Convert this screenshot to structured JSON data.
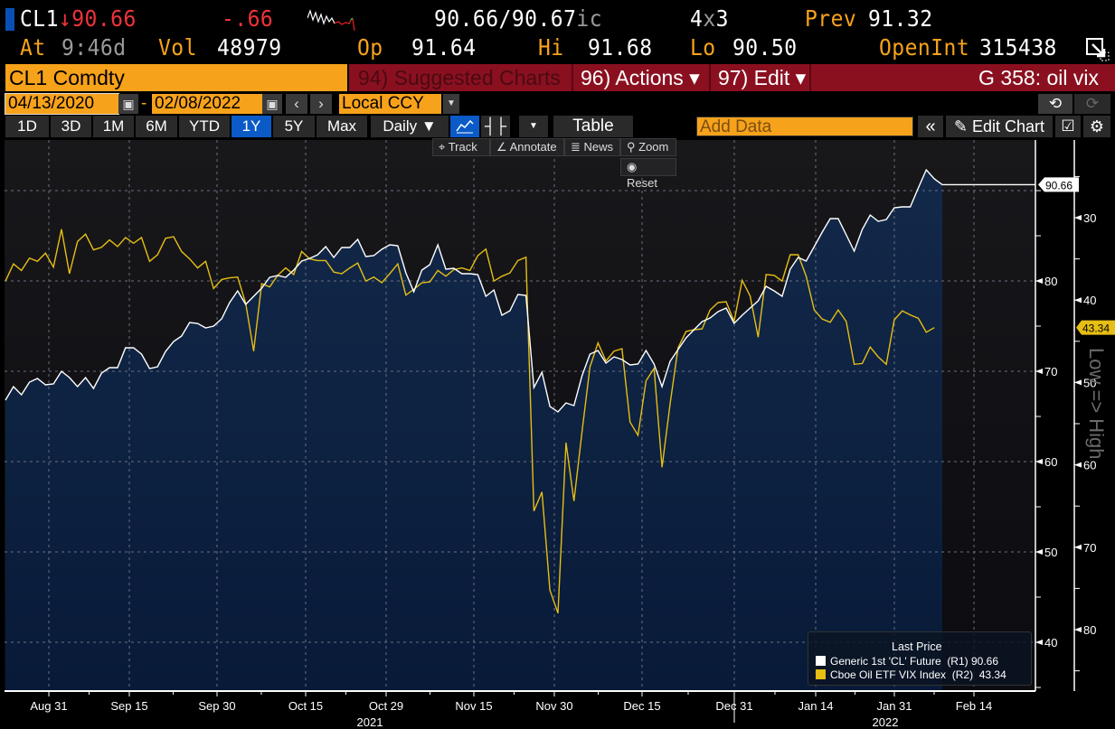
{
  "header": {
    "ticker": "CL1",
    "arrow": "↓",
    "last": "90.66",
    "change": "-.66",
    "bid_ask": "90.66",
    "ask": "/90.67",
    "ask_suffix": "ic",
    "size_a": "4",
    "size_x": "x",
    "size_b": "3",
    "prev_label": "Prev",
    "prev": "91.32",
    "at_label": "At",
    "time": "9:46d",
    "vol_label": "Vol",
    "vol": "48979",
    "op_label": "Op",
    "op": "91.64",
    "hi_label": "Hi",
    "hi": "91.68",
    "lo_label": "Lo",
    "lo": "90.50",
    "oi_label": "OpenInt",
    "oi": "315438"
  },
  "command": {
    "security": "CL1 Comdty",
    "suggested": "94) Suggested Charts",
    "actions": "96) Actions ▾",
    "edit": "97) Edit ▾",
    "title": "G 358: oil vix"
  },
  "range": {
    "start": "04/13/2020",
    "sep": "-",
    "end": "02/08/2022",
    "currency": "Local CCY"
  },
  "toolbar": {
    "periods": [
      "1D",
      "3D",
      "1M",
      "6M",
      "YTD",
      "1Y",
      "5Y",
      "Max"
    ],
    "selected_period": "1Y",
    "frequency": "Daily ▼",
    "table": "Table",
    "add_data_placeholder": "Add Data",
    "collapse": "«",
    "edit_chart": "Edit Chart",
    "track": "Track",
    "annotate": "Annotate",
    "news": "News",
    "zoom": "Zoom",
    "reset": "Reset"
  },
  "colors": {
    "cl1": "#ffffff",
    "vix": "#e6be14",
    "orange": "#f7a21b",
    "red_bar": "#8a1020",
    "area_top": "#13294a",
    "area_bottom": "#081a38"
  },
  "chart_data": {
    "type": "line",
    "title": "",
    "legend_title": "Last Price",
    "legend_position": "bottom-right",
    "x_tick_labels": [
      "Aug 31",
      "Sep 15",
      "Sep 30",
      "Oct 15",
      "Oct 29",
      "Nov 15",
      "Nov 30",
      "Dec 15",
      "Dec 31",
      "Jan 14",
      "Jan 31",
      "Feb 14"
    ],
    "year_labels": [
      "2021",
      "2022"
    ],
    "right_axis_1": {
      "ticks": [
        40,
        50,
        60,
        70,
        80
      ],
      "range": [
        34.6,
        95.4
      ],
      "last_tag": "90.66"
    },
    "right_axis_2": {
      "ticks": [
        30,
        40,
        50,
        60,
        70,
        80
      ],
      "range": [
        20.3,
        87
      ],
      "inverted": true,
      "last_tag": "43.34",
      "label": "Low => High"
    },
    "series": [
      {
        "name": "Generic 1st 'CL' Future",
        "axis": "R1",
        "legend_axis": "(R1)",
        "last": "90.66",
        "area": true,
        "values": [
          66.8,
          68.3,
          67.4,
          68.8,
          69.2,
          68.5,
          68.6,
          70.0,
          69.3,
          68.3,
          69.3,
          68.1,
          69.8,
          70.4,
          70.4,
          72.6,
          72.6,
          71.9,
          70.3,
          70.5,
          72.2,
          73.3,
          73.9,
          75.4,
          75.3,
          74.8,
          75.0,
          75.8,
          77.6,
          78.9,
          77.4,
          78.3,
          79.2,
          80.4,
          80.6,
          80.4,
          81.2,
          82.2,
          82.5,
          82.9,
          83.8,
          82.6,
          83.7,
          83.7,
          84.6,
          82.7,
          82.8,
          83.5,
          84.0,
          83.9,
          80.9,
          78.8,
          81.2,
          81.8,
          84.0,
          81.3,
          81.4,
          80.8,
          80.8,
          80.7,
          78.3,
          79.0,
          76.2,
          76.7,
          78.5,
          78.4,
          68.2,
          69.9,
          66.1,
          65.5,
          66.5,
          66.2,
          69.5,
          71.9,
          72.3,
          70.9,
          71.6,
          71.3,
          70.7,
          70.8,
          72.3,
          70.8,
          68.3,
          71.1,
          72.4,
          73.7,
          74.6,
          75.5,
          75.9,
          76.6,
          77.0,
          75.3,
          76.2,
          77.0,
          77.8,
          79.4,
          78.9,
          78.3,
          81.3,
          82.6,
          82.2,
          83.8,
          85.4,
          86.9,
          86.9,
          85.1,
          83.3,
          85.7,
          87.3,
          86.6,
          86.8,
          88.1,
          88.2,
          88.2,
          90.3,
          92.3,
          91.3,
          90.66
        ]
      },
      {
        "name": "Cboe Oil ETF VIX Index",
        "axis": "R2",
        "legend_axis": "(R2)",
        "last": "43.34",
        "area": false,
        "values": [
          37.7,
          35.6,
          36.4,
          34.9,
          35.3,
          34.3,
          36.0,
          31.4,
          36.8,
          32.9,
          32.0,
          33.9,
          33.6,
          32.7,
          33.5,
          32.4,
          33.1,
          32.4,
          35.3,
          34.5,
          32.5,
          32.3,
          34.1,
          35.0,
          36.1,
          35.3,
          38.6,
          37.5,
          37.3,
          37.2,
          40.4,
          46.2,
          38.0,
          38.4,
          37.0,
          36.1,
          36.9,
          34.1,
          35.0,
          35.2,
          35.2,
          36.6,
          36.8,
          36.1,
          35.5,
          37.7,
          37.2,
          37.9,
          36.8,
          35.6,
          39.4,
          38.7,
          37.9,
          37.8,
          36.4,
          37.1,
          36.3,
          36.1,
          36.4,
          34.6,
          33.8,
          37.7,
          37.1,
          36.7,
          35.2,
          34.8,
          65.6,
          63.3,
          75.2,
          78.0,
          57.3,
          64.4,
          56.0,
          48.1,
          45.2,
          47.4,
          46.2,
          45.9,
          54.8,
          56.4,
          49.8,
          48.3,
          60.3,
          52.6,
          45.8,
          43.8,
          43.6,
          43.5,
          41.2,
          40.3,
          40.2,
          42.6,
          37.6,
          39.5,
          44.5,
          36.9,
          37.0,
          37.7,
          34.5,
          34.5,
          37.1,
          41.2,
          42.3,
          42.7,
          41.2,
          42.6,
          47.8,
          47.7,
          45.7,
          46.9,
          47.8,
          42.4,
          41.3,
          41.8,
          42.2,
          43.9,
          43.34
        ]
      }
    ]
  }
}
